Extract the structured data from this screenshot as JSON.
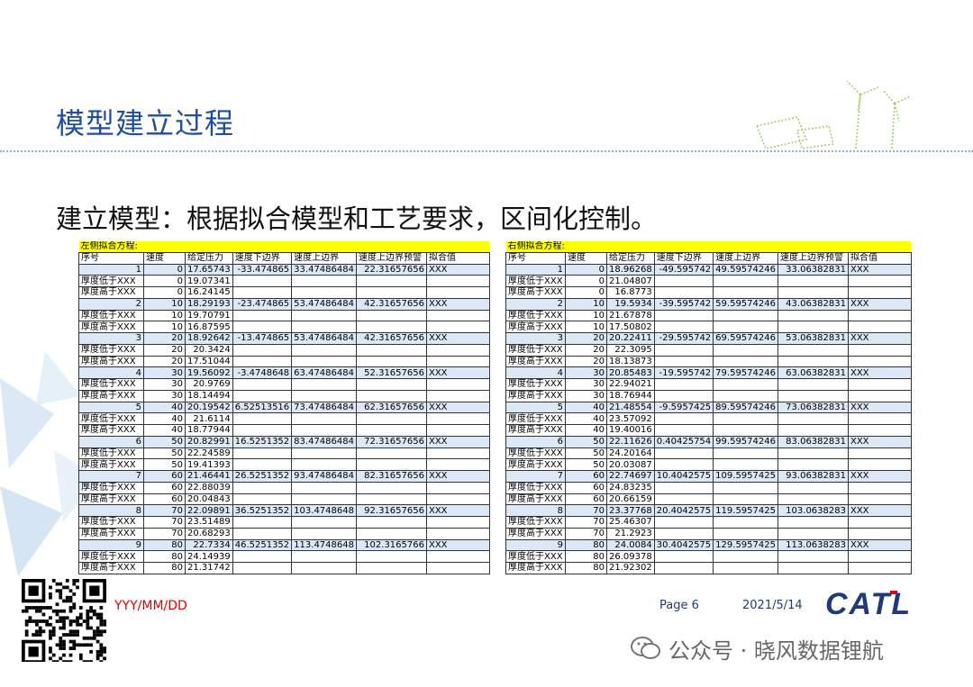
{
  "title": "模型建立过程",
  "subtitle": "建立模型：根据拟合模型和工艺要求，区间化控制。",
  "left_table": {
    "caption": "左侧拟合方程:",
    "headers": [
      "序号",
      "速度",
      "给定压力",
      "速度下边界",
      "速度上边界",
      "速度上边界预警",
      "拟合值"
    ],
    "rows": [
      [
        "1",
        "0",
        "17.65743",
        "-33.474865",
        "33.47486484",
        "22.31657656",
        "XXX"
      ],
      [
        "厚度低于XXX",
        "0",
        "19.07341",
        "",
        "",
        "",
        ""
      ],
      [
        "厚度高于XXX",
        "0",
        "16.24145",
        "",
        "",
        "",
        ""
      ],
      [
        "2",
        "10",
        "18.29193",
        "-23.474865",
        "53.47486484",
        "42.31657656",
        "XXX"
      ],
      [
        "厚度低于XXX",
        "10",
        "19.70791",
        "",
        "",
        "",
        ""
      ],
      [
        "厚度高于XXX",
        "10",
        "16.87595",
        "",
        "",
        "",
        ""
      ],
      [
        "3",
        "20",
        "18.92642",
        "-13.474865",
        "53.47486484",
        "42.31657656",
        "XXX"
      ],
      [
        "厚度低于XXX",
        "20",
        "20.3424",
        "",
        "",
        "",
        ""
      ],
      [
        "厚度高于XXX",
        "20",
        "17.51044",
        "",
        "",
        "",
        ""
      ],
      [
        "4",
        "30",
        "19.56092",
        "-3.4748648",
        "63.47486484",
        "52.31657656",
        "XXX"
      ],
      [
        "厚度低于XXX",
        "30",
        "20.9769",
        "",
        "",
        "",
        ""
      ],
      [
        "厚度高于XXX",
        "30",
        "18.14494",
        "",
        "",
        "",
        ""
      ],
      [
        "5",
        "40",
        "20.19542",
        "6.52513516",
        "73.47486484",
        "62.31657656",
        "XXX"
      ],
      [
        "厚度低于XXX",
        "40",
        "21.6114",
        "",
        "",
        "",
        ""
      ],
      [
        "厚度高于XXX",
        "40",
        "18.77944",
        "",
        "",
        "",
        ""
      ],
      [
        "6",
        "50",
        "20.82991",
        "16.5251352",
        "83.47486484",
        "72.31657656",
        "XXX"
      ],
      [
        "厚度低于XXX",
        "50",
        "22.24589",
        "",
        "",
        "",
        ""
      ],
      [
        "厚度高于XXX",
        "50",
        "19.41393",
        "",
        "",
        "",
        ""
      ],
      [
        "7",
        "60",
        "21.46441",
        "26.5251352",
        "93.47486484",
        "82.31657656",
        "XXX"
      ],
      [
        "厚度低于XXX",
        "60",
        "22.88039",
        "",
        "",
        "",
        ""
      ],
      [
        "厚度高于XXX",
        "60",
        "20.04843",
        "",
        "",
        "",
        ""
      ],
      [
        "8",
        "70",
        "22.09891",
        "36.5251352",
        "103.4748648",
        "92.31657656",
        "XXX"
      ],
      [
        "厚度低于XXX",
        "70",
        "23.51489",
        "",
        "",
        "",
        ""
      ],
      [
        "厚度高于XXX",
        "70",
        "20.68293",
        "",
        "",
        "",
        ""
      ],
      [
        "9",
        "80",
        "22.7334",
        "46.5251352",
        "113.4748648",
        "102.3165766",
        "XXX"
      ],
      [
        "厚度低于XXX",
        "80",
        "24.14939",
        "",
        "",
        "",
        ""
      ],
      [
        "厚度高于XXX",
        "80",
        "21.31742",
        "",
        "",
        "",
        ""
      ]
    ]
  },
  "right_table": {
    "caption": "右侧拟合方程:",
    "headers": [
      "序号",
      "速度",
      "给定压力",
      "速度下边界",
      "速度上边界",
      "速度上边界预警",
      "拟合值"
    ],
    "rows": [
      [
        "1",
        "0",
        "18.96268",
        "-49.595742",
        "49.59574246",
        "33.06382831",
        "XXX"
      ],
      [
        "厚度低于XXX",
        "0",
        "21.04807",
        "",
        "",
        "",
        ""
      ],
      [
        "厚度高于XXX",
        "0",
        "16.8773",
        "",
        "",
        "",
        ""
      ],
      [
        "2",
        "10",
        "19.5934",
        "-39.595742",
        "59.59574246",
        "43.06382831",
        "XXX"
      ],
      [
        "厚度低于XXX",
        "10",
        "21.67878",
        "",
        "",
        "",
        ""
      ],
      [
        "厚度高于XXX",
        "10",
        "17.50802",
        "",
        "",
        "",
        ""
      ],
      [
        "3",
        "20",
        "20.22411",
        "-29.595742",
        "69.59574246",
        "53.06382831",
        "XXX"
      ],
      [
        "厚度低于XXX",
        "20",
        "22.3095",
        "",
        "",
        "",
        ""
      ],
      [
        "厚度高于XXX",
        "20",
        "18.13873",
        "",
        "",
        "",
        ""
      ],
      [
        "4",
        "30",
        "20.85483",
        "-19.595742",
        "79.59574246",
        "63.06382831",
        "XXX"
      ],
      [
        "厚度低于XXX",
        "30",
        "22.94021",
        "",
        "",
        "",
        ""
      ],
      [
        "厚度高于XXX",
        "30",
        "18.76944",
        "",
        "",
        "",
        ""
      ],
      [
        "5",
        "40",
        "21.48554",
        "-9.5957425",
        "89.59574246",
        "73.06382831",
        "XXX"
      ],
      [
        "厚度低于XXX",
        "40",
        "23.57092",
        "",
        "",
        "",
        ""
      ],
      [
        "厚度高于XXX",
        "40",
        "19.40016",
        "",
        "",
        "",
        ""
      ],
      [
        "6",
        "50",
        "22.11626",
        "0.40425754",
        "99.59574246",
        "83.06382831",
        "XXX"
      ],
      [
        "厚度低于XXX",
        "50",
        "24.20164",
        "",
        "",
        "",
        ""
      ],
      [
        "厚度高于XXX",
        "50",
        "20.03087",
        "",
        "",
        "",
        ""
      ],
      [
        "7",
        "60",
        "22.74697",
        "10.4042575",
        "109.5957425",
        "93.06382831",
        "XXX"
      ],
      [
        "厚度低于XXX",
        "60",
        "24.83235",
        "",
        "",
        "",
        ""
      ],
      [
        "厚度高于XXX",
        "60",
        "20.66159",
        "",
        "",
        "",
        ""
      ],
      [
        "8",
        "70",
        "23.37768",
        "20.4042575",
        "119.5957425",
        "103.0638283",
        "XXX"
      ],
      [
        "厚度低于XXX",
        "70",
        "25.46307",
        "",
        "",
        "",
        ""
      ],
      [
        "厚度高于XXX",
        "70",
        "21.2923",
        "",
        "",
        "",
        ""
      ],
      [
        "9",
        "80",
        "24.0084",
        "30.4042575",
        "129.5957425",
        "113.0638283",
        "XXX"
      ],
      [
        "厚度低于XXX",
        "80",
        "26.09378",
        "",
        "",
        "",
        ""
      ],
      [
        "厚度高于XXX",
        "80",
        "21.92302",
        "",
        "",
        "",
        ""
      ]
    ]
  },
  "footer": {
    "date_placeholder": "YYY/MM/DD",
    "page": "Page 6",
    "date": "2021/5/14",
    "logo_text": "CATL",
    "watermark": "公众号 · 晓风数据锂航"
  },
  "colors": {
    "title": "#1f4f9c",
    "caption_bg": "#ffff00",
    "row_highlight": "#dce8f5",
    "date_red": "#e00000",
    "logo_blue": "#1f3a78",
    "logo_red": "#e60012"
  }
}
